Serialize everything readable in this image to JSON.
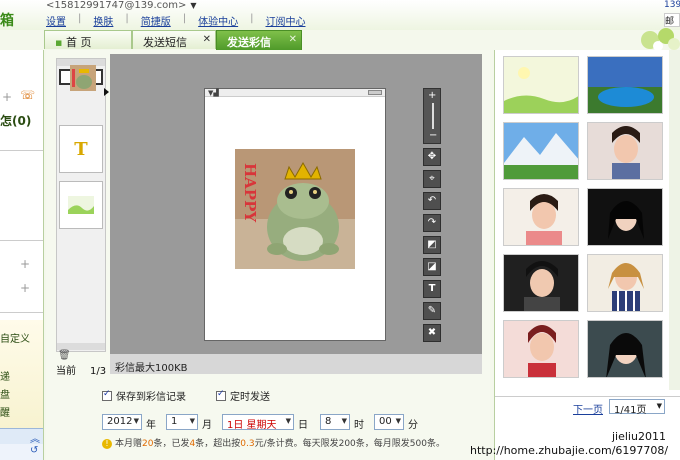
{
  "header": {
    "email": "<15812991747@139.com>",
    "nav": [
      "设置",
      "换肤",
      "简捷版",
      "体验中心",
      "订阅中心"
    ],
    "right_fragment": "139"
  },
  "tabs": [
    {
      "label": "首 页",
      "closable": false,
      "active": false
    },
    {
      "label": "发送短信",
      "closable": true,
      "active": false
    },
    {
      "label": "发送彩信",
      "closable": true,
      "active": true
    }
  ],
  "sidebar": {
    "count_text": "怎(0)",
    "items": [
      "自定义",
      "",
      "递",
      "盘",
      "醒"
    ]
  },
  "editor": {
    "pager_label": "当前",
    "pager_value": "1/3",
    "size_limit": "彩信最大100KB",
    "photo_text": "HAPPY",
    "thumb_text_icon": "T",
    "tools": [
      "plus-icon",
      "minus-icon",
      "move-icon",
      "crosshair-icon",
      "rotate-left-icon",
      "rotate-right-icon",
      "bring-front-icon",
      "send-back-icon",
      "text-icon",
      "edit-icon",
      "delete-icon"
    ]
  },
  "options": {
    "save_record": "保存到彩信记录",
    "timed_send": "定时发送",
    "year": "2012",
    "year_unit": "年",
    "month": "1",
    "month_unit": "月",
    "day": "1日  星期天",
    "day_unit": "日",
    "hour": "8",
    "hour_unit": "时",
    "minute": "00",
    "minute_unit": "分",
    "note_parts": [
      "本月赠",
      "20",
      "条，已发",
      "4",
      "条，超出按",
      "0.3",
      "元/条计费。每天限发200条，每月限发500条。"
    ]
  },
  "gallery": {
    "next_label": "下一页",
    "page_select": "1/41页"
  },
  "watermark": {
    "line1": "jieliu2011",
    "line2": "http://home.zhubajie.com/6197708/"
  },
  "colors": {
    "accent_green": "#5aa832",
    "link_blue": "#1a3f9b",
    "stage_gray": "#9a9a9a",
    "tool_dark": "#4f4f4f"
  }
}
